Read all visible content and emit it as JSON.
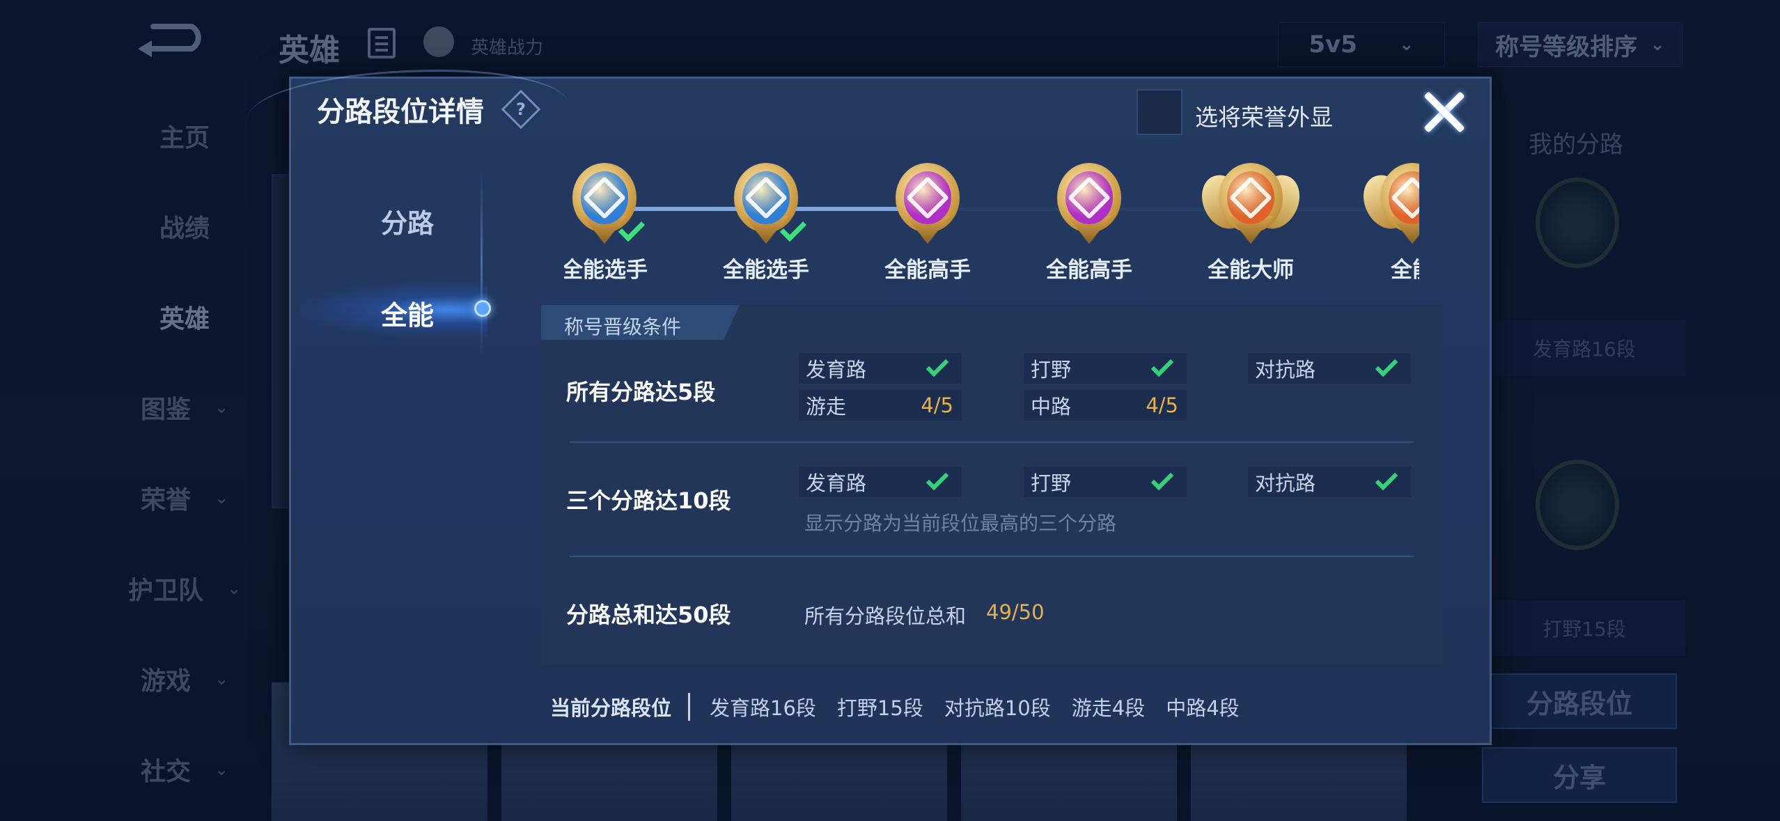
{
  "topbar": {
    "title": "英雄",
    "hero_power": "英雄战力",
    "mode": "5v5",
    "sort": "称号等级排序"
  },
  "nav": {
    "items": [
      {
        "label": "主页",
        "has_chevron": false
      },
      {
        "label": "战绩",
        "has_chevron": false
      },
      {
        "label": "英雄",
        "has_chevron": false,
        "active": true
      },
      {
        "label": "图鉴",
        "has_chevron": true
      },
      {
        "label": "荣誉",
        "has_chevron": true
      },
      {
        "label": "护卫队",
        "has_chevron": true
      },
      {
        "label": "游戏",
        "has_chevron": true
      },
      {
        "label": "社交",
        "has_chevron": true
      }
    ]
  },
  "right_panel": {
    "title": "我的分路",
    "lane1": "发育路16段",
    "lane2": "打野15段",
    "lane_rank_button": "分路段位",
    "share_button": "分享"
  },
  "modal": {
    "title": "分路段位详情",
    "help": "?",
    "honor_toggle": "选将荣誉外显",
    "tabs": [
      "分路",
      "全能"
    ],
    "active_tab": "全能",
    "ranks": [
      {
        "name": "全能选手",
        "color": "#2f7fd6",
        "achieved": true,
        "wings": false
      },
      {
        "name": "全能选手",
        "color": "#2f7fd6",
        "achieved": true,
        "wings": false
      },
      {
        "name": "全能高手",
        "color": "#b02fc7",
        "achieved": false,
        "wings": false
      },
      {
        "name": "全能高手",
        "color": "#b02fc7",
        "achieved": false,
        "wings": false
      },
      {
        "name": "全能大师",
        "color": "#e0622a",
        "achieved": false,
        "wings": true
      },
      {
        "name": "全能",
        "color": "#e0622a",
        "achieved": false,
        "wings": true
      }
    ],
    "conditions_header": "称号晋级条件",
    "condition1": {
      "title": "所有分路达5段",
      "lanes": [
        {
          "name": "发育路",
          "done": true,
          "progress": ""
        },
        {
          "name": "打野",
          "done": true,
          "progress": ""
        },
        {
          "name": "对抗路",
          "done": true,
          "progress": ""
        },
        {
          "name": "游走",
          "done": false,
          "progress": "4/5"
        },
        {
          "name": "中路",
          "done": false,
          "progress": "4/5"
        }
      ]
    },
    "condition2": {
      "title": "三个分路达10段",
      "lanes": [
        {
          "name": "发育路",
          "done": true
        },
        {
          "name": "打野",
          "done": true
        },
        {
          "name": "对抗路",
          "done": true
        }
      ],
      "note": "显示分路为当前段位最高的三个分路"
    },
    "condition3": {
      "title": "分路总和达50段",
      "label": "所有分路段位总和",
      "value": "49/50"
    },
    "footer": {
      "current_label": "当前分路段位",
      "segments": [
        "发育路16段",
        "打野15段",
        "对抗路10段",
        "游走4段",
        "中路4段"
      ]
    }
  },
  "colors": {
    "accent_check": "#39d07a",
    "progress": "#e8b24a",
    "modal_bg": "#223760"
  }
}
